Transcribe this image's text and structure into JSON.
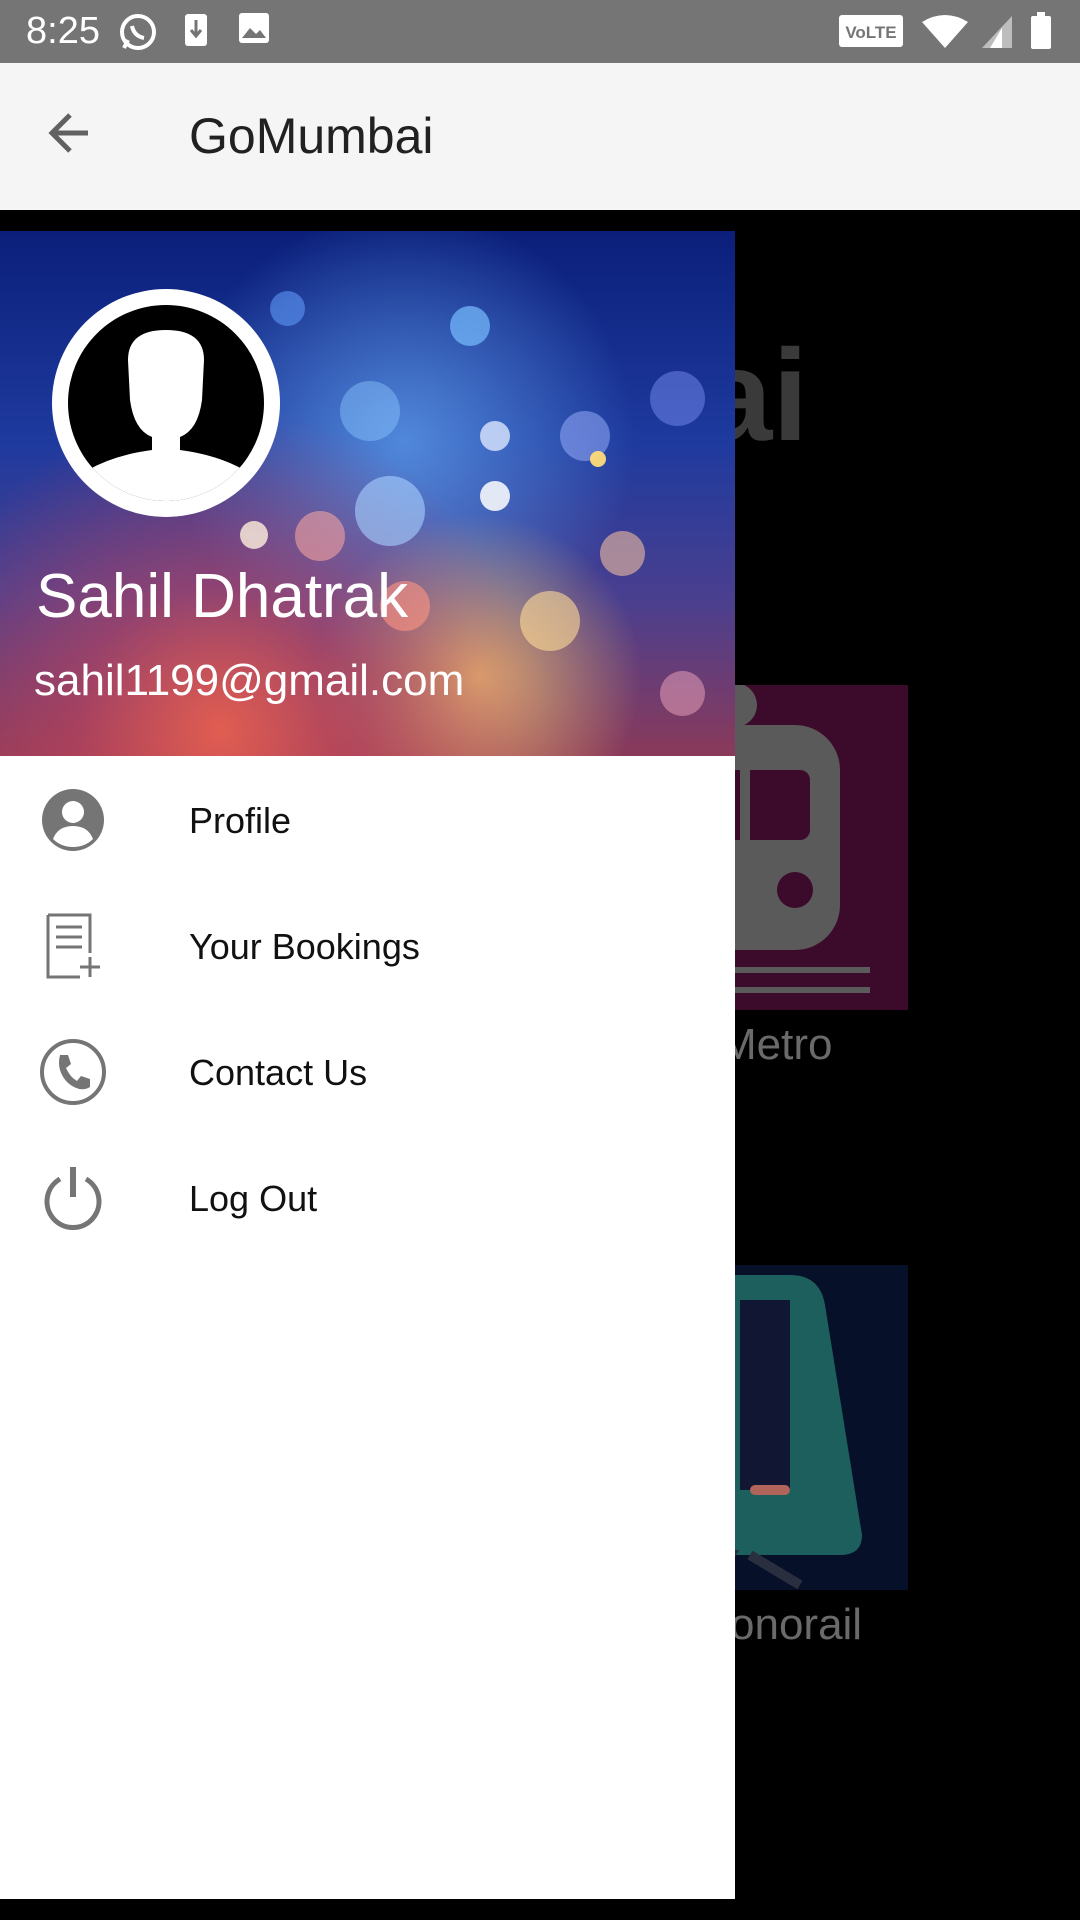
{
  "status_bar": {
    "time": "8:25",
    "icons": [
      "whatsapp-icon",
      "download-icon",
      "image-icon",
      "volte-icon",
      "wifi-icon",
      "signal-icon",
      "battery-icon"
    ],
    "volte_label": "VoLTE"
  },
  "app_bar": {
    "title": "GoMumbai",
    "back_icon": "arrow-back-icon"
  },
  "drawer": {
    "user_name": "Sahil Dhatrak",
    "user_email": "sahil1199@gmail.com",
    "menu": [
      {
        "label": "Profile",
        "icon": "account-circle-icon"
      },
      {
        "label": "Your Bookings",
        "icon": "document-add-icon"
      },
      {
        "label": "Contact Us",
        "icon": "phone-icon"
      },
      {
        "label": "Log Out",
        "icon": "power-icon"
      }
    ]
  },
  "background_screen": {
    "logo_fragment": "ai",
    "tiles": [
      {
        "label": "Metro",
        "icon": "train-icon"
      },
      {
        "label": "onorail",
        "icon": "monorail-icon"
      }
    ]
  },
  "colors": {
    "status_bar": "#757575",
    "app_bar": "#f5f5f5",
    "scrim": "#000000",
    "drawer_bg": "#ffffff"
  }
}
